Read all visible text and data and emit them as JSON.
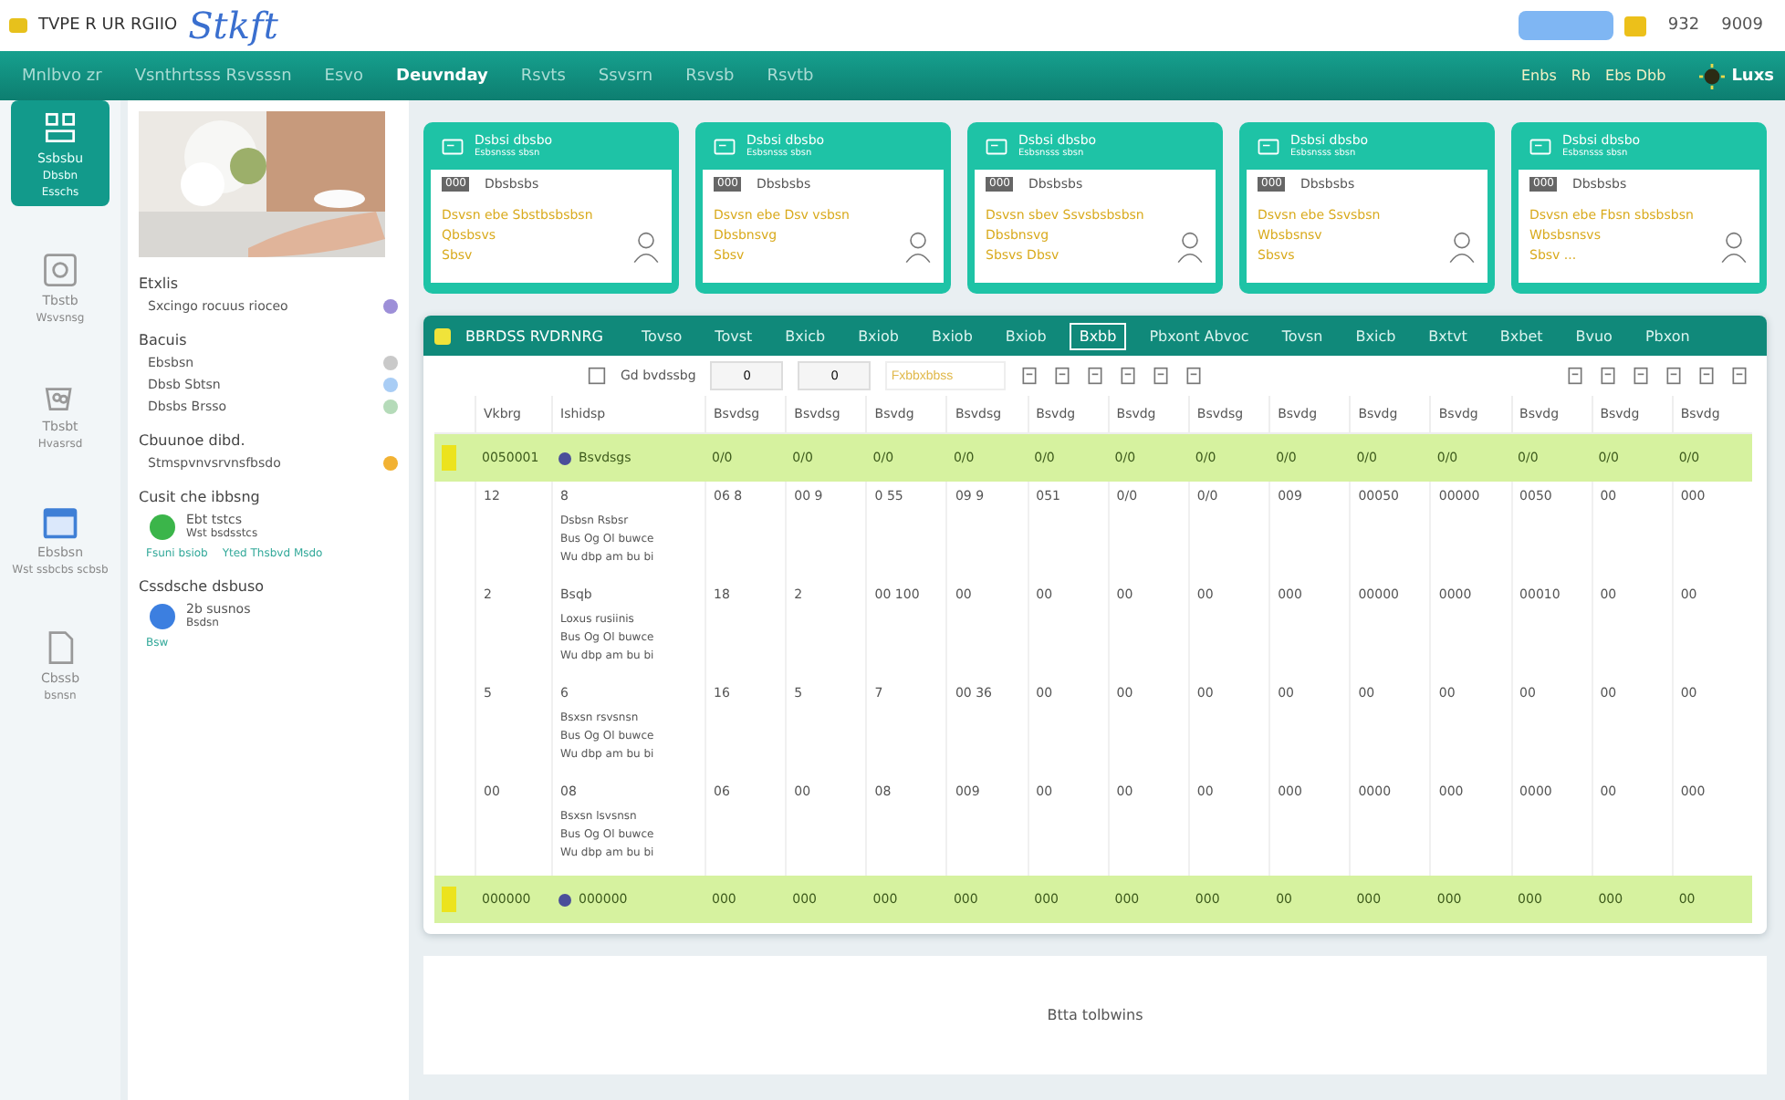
{
  "header": {
    "brand": "TVPE R UR RGIIO",
    "title": "Stkft",
    "links": [
      "932",
      "9009"
    ]
  },
  "nav": {
    "items": [
      {
        "label": "Mnlbvo zr",
        "selected": false
      },
      {
        "label": "Vsnthrtsss Rsvsssn",
        "selected": false
      },
      {
        "label": "Esvo",
        "selected": false
      },
      {
        "label": "Deuvnday",
        "selected": true
      },
      {
        "label": "Rsvts",
        "selected": false
      },
      {
        "label": "Ssvsrn",
        "selected": false
      },
      {
        "label": "Rsvsb",
        "selected": false
      },
      {
        "label": "Rsvtb",
        "selected": false
      }
    ],
    "right_links": [
      "Enbs",
      "Rb",
      "Ebs Dbb"
    ],
    "logo": "Luxs"
  },
  "rail": [
    {
      "label": "Ssbsbu",
      "sub": "Dbsbn",
      "note": "Esschs",
      "selected": true
    },
    {
      "label": "Tbstb",
      "sub": "Wsvsnsg",
      "selected": false
    },
    {
      "label": "Tbsbt",
      "sub": "Hvasrsd",
      "selected": false
    },
    {
      "label": "Ebsbsn",
      "sub": "Wst ssbcbs scbsb",
      "selected": false
    },
    {
      "label": "Cbssb",
      "sub": "bsnsn",
      "selected": false
    }
  ],
  "panel": {
    "sections": [
      {
        "title": "Etxlis",
        "items": [
          {
            "label": "Sxcingo rocuus rioceo",
            "color": "#9d8fd8"
          }
        ]
      },
      {
        "title": "Bacuis",
        "items": [
          {
            "label": "Ebsbsn",
            "color": "#c9c9c9"
          },
          {
            "label": "Dbsb Sbtsn",
            "color": "#a9cdf5"
          },
          {
            "label": "Dbsbs Brsso",
            "color": "#b5dbb9"
          }
        ]
      },
      {
        "title": "Cbuunoe dibd.",
        "items": [
          {
            "label": "Stmspvnvsrvnsfbsdo",
            "color": "#f2b233"
          }
        ]
      },
      {
        "title": "Cusit che ibbsng",
        "contact": {
          "name": "Ebt tstcs",
          "detail": "Wst bsdsstcs",
          "color": "#3bb54a"
        },
        "links": [
          "Fsuni bsiob",
          "Yted Thsbvd Msdo"
        ]
      },
      {
        "title": "Cssdsche dsbuso",
        "contact": {
          "name": "2b susnos",
          "detail": "Bsdsn",
          "color": "#3c7fe0"
        },
        "links": [
          "Bsw"
        ]
      }
    ]
  },
  "cards": [
    {
      "title": "Dsbsi dbsbo",
      "subtitle": "Esbsnsss sbsn",
      "tag": "000",
      "name": "Dbsbsbs",
      "lines": [
        "Dsvsn ebe  Sbstbsbsbsn",
        "Qbsbsvs",
        "Sbsv"
      ]
    },
    {
      "title": "Dsbsi dbsbo",
      "subtitle": "Esbsnsss sbsn",
      "tag": "000",
      "name": "Dbsbsbs",
      "lines": [
        "Dsvsn ebe  Dsv vsbsn",
        "Dbsbnsvg",
        "Sbsv"
      ]
    },
    {
      "title": "Dsbsi dbsbo",
      "subtitle": "Esbsnsss sbsn",
      "tag": "000",
      "name": "Dbsbsbs",
      "lines": [
        "Dsvsn sbev  Ssvsbsbsbsn",
        "Dbsbnsvg",
        "Sbsvs Dbsv"
      ]
    },
    {
      "title": "Dsbsi dbsbo",
      "subtitle": "Esbsnsss sbsn",
      "tag": "000",
      "name": "Dbsbsbs",
      "lines": [
        "Dsvsn ebe  Ssvsbsn",
        "Wbsbsnsv",
        "Sbsvs"
      ]
    },
    {
      "title": "Dsbsi dbsbo",
      "subtitle": "Esbsnsss sbsn",
      "tag": "000",
      "name": "Dbsbsbs",
      "lines": [
        "Dsvsn ebe  Fbsn sbsbsbsn",
        "Wbsbsnsvs",
        "Sbsv ..."
      ]
    }
  ],
  "table_panel": {
    "title": "BBRDSS RVDRNRG",
    "tabs": [
      {
        "label": "Tovso",
        "selected": false
      },
      {
        "label": "Tovst",
        "selected": false
      },
      {
        "label": "Bxicb",
        "selected": false
      },
      {
        "label": "Bxiob",
        "selected": false
      },
      {
        "label": "Bxiob",
        "selected": false
      },
      {
        "label": "Bxiob",
        "selected": false
      },
      {
        "label": "Bxbb",
        "selected": true
      },
      {
        "label": "Pbxont Abvoc",
        "selected": false
      },
      {
        "label": "Tovsn",
        "selected": false
      },
      {
        "label": "Bxicb",
        "selected": false
      },
      {
        "label": "Bxtvt",
        "selected": false
      },
      {
        "label": "Bxbet",
        "selected": false
      },
      {
        "label": "Bvuo",
        "selected": false
      },
      {
        "label": "Pbxon",
        "selected": false
      }
    ],
    "toolbar": {
      "label": "Gd bvdssbg",
      "inputs": [
        "0",
        "0"
      ],
      "placeholder": "Fxbbxbbss"
    },
    "columns": [
      "Vkbrg",
      "Ishidsp",
      "Bsvdsg",
      "Bsvdsg",
      "Bsvdg",
      "Bsvdsg",
      "Bsvdg",
      "Bsvdg",
      "Bsvdsg",
      "Bsvdg",
      "Bsvdg",
      "Bsvdg",
      "Bsvdg",
      "Bsvdg",
      "Bsvdg"
    ],
    "rows": [
      {
        "kind": "total",
        "cells": [
          "0050001",
          "Bsvdsgs",
          "0/0",
          "0/0",
          "0/0",
          "0/0",
          "0/0",
          "0/0",
          "0/0",
          "0/0",
          "0/0",
          "0/0",
          "0/0",
          "0/0",
          "0/0"
        ]
      },
      {
        "kind": "data",
        "cells": [
          "12",
          "8",
          "06 8",
          "00 9",
          "0 55",
          "09 9",
          "051",
          "0/0",
          "0/0",
          "009",
          "00050",
          "00000",
          "0050",
          "00",
          "000"
        ],
        "details": [
          "Dsbsn Rsbsr",
          "Bus  Og  Ol  buwce",
          "Wu  dbp  am  bu bi"
        ]
      },
      {
        "kind": "data",
        "cells": [
          "2",
          "Bsqb",
          "18",
          "2",
          "00 100",
          "00",
          "00",
          "00",
          "00",
          "000",
          "00000",
          "0000",
          "00010",
          "00",
          "00"
        ],
        "details": [
          "Loxus rusiinis",
          "Bus  Og  Ol  buwce",
          "Wu  dbp  am  bu bi"
        ]
      },
      {
        "kind": "data",
        "cells": [
          "5",
          "6",
          "16",
          "5",
          "7",
          "00 36",
          "00",
          "00",
          "00",
          "00",
          "00",
          "00",
          "00",
          "00",
          "00"
        ],
        "details": [
          "Bsxsn rsvsnsn",
          "Bus  Og  Ol  buwce",
          "Wu  dbp  am  bu bi"
        ]
      },
      {
        "kind": "data",
        "cells": [
          "00",
          "08",
          "06",
          "00",
          "08",
          "009",
          "00",
          "00",
          "00",
          "000",
          "0000",
          "000",
          "0000",
          "00",
          "000"
        ],
        "details": [
          "Bsxsn lsvsnsn",
          "Bus  Og  Ol  buwce",
          "Wu  dbp  am  bu bi"
        ]
      },
      {
        "kind": "total",
        "cells": [
          "000000",
          "000000",
          "000",
          "000",
          "000",
          "000",
          "000",
          "000",
          "000",
          "00",
          "000",
          "000",
          "000",
          "000",
          "00"
        ]
      }
    ]
  },
  "footer_panel": {
    "text": "Btta tolbwins"
  }
}
